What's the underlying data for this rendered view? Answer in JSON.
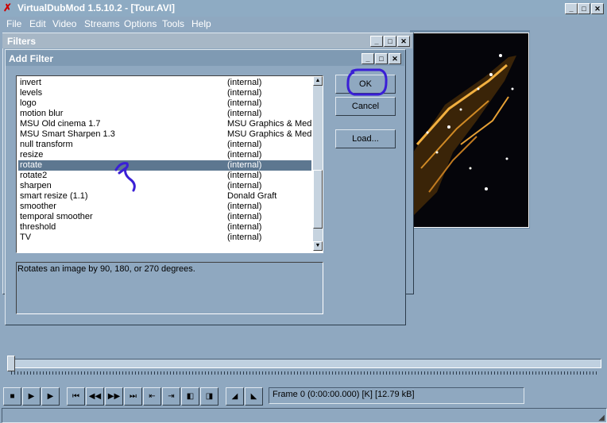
{
  "app": {
    "title": "VirtualDubMod 1.5.10.2 - [Tour.AVI]",
    "menu": [
      "File",
      "Edit",
      "Video",
      "Streams",
      "Options",
      "Tools",
      "Help"
    ]
  },
  "filters_dialog": {
    "title": "Filters"
  },
  "add_filter_dialog": {
    "title": "Add Filter",
    "filters": [
      {
        "name": "invert",
        "source": "(internal)"
      },
      {
        "name": "levels",
        "source": "(internal)"
      },
      {
        "name": "logo",
        "source": "(internal)"
      },
      {
        "name": "motion blur",
        "source": "(internal)"
      },
      {
        "name": "MSU Old cinema 1.7",
        "source": "MSU Graphics & Media"
      },
      {
        "name": "MSU Smart Sharpen 1.3",
        "source": "MSU Graphics & Media"
      },
      {
        "name": "null transform",
        "source": "(internal)"
      },
      {
        "name": "resize",
        "source": "(internal)"
      },
      {
        "name": "rotate",
        "source": "(internal)"
      },
      {
        "name": "rotate2",
        "source": "(internal)"
      },
      {
        "name": "sharpen",
        "source": "(internal)"
      },
      {
        "name": "smart resize (1.1)",
        "source": "Donald Graft"
      },
      {
        "name": "smoother",
        "source": "(internal)"
      },
      {
        "name": "temporal smoother",
        "source": "(internal)"
      },
      {
        "name": "threshold",
        "source": "(internal)"
      },
      {
        "name": "TV",
        "source": "(internal)"
      }
    ],
    "selected_index": 8,
    "description": "Rotates an image by 90, 180, or 270 degrees.",
    "ok_label": "OK",
    "cancel_label": "Cancel",
    "load_label": "Load..."
  },
  "status": {
    "frame": "Frame 0 (0:00:00.000) [K] [12.79 kB]"
  },
  "colors": {
    "annotation": "#3a1fd6",
    "selection": "#5d7790"
  }
}
